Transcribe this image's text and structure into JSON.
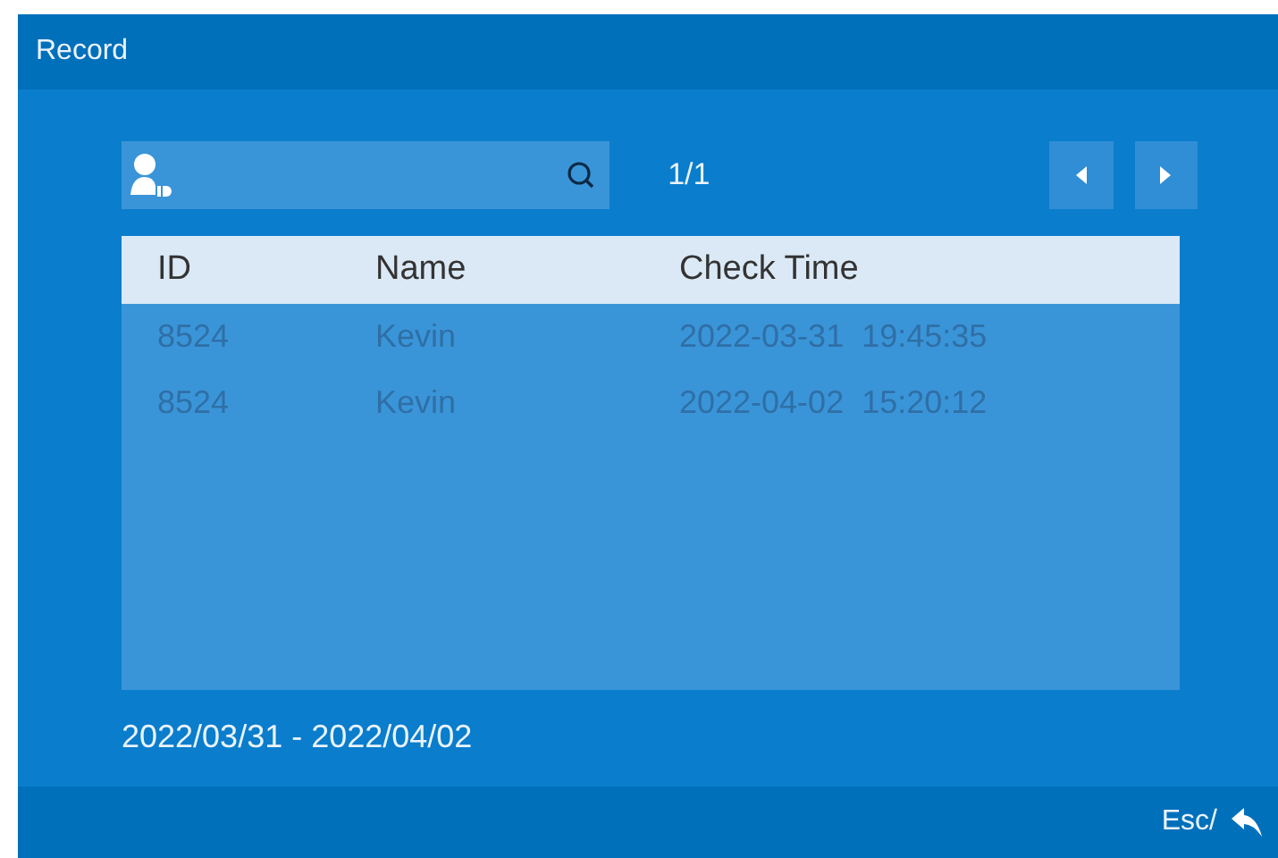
{
  "window": {
    "title": "Record"
  },
  "page": "1/1",
  "table": {
    "columns": [
      "ID",
      "Name",
      "Check Time"
    ],
    "rows": [
      [
        "8524",
        "Kevin",
        "2022-03-31  19:45:35"
      ],
      [
        "8524",
        "Kevin",
        "2022-04-02  15:20:12"
      ]
    ]
  },
  "date_range": "2022/03/31 - 2022/04/02",
  "footer": {
    "hint": "Esc/"
  }
}
